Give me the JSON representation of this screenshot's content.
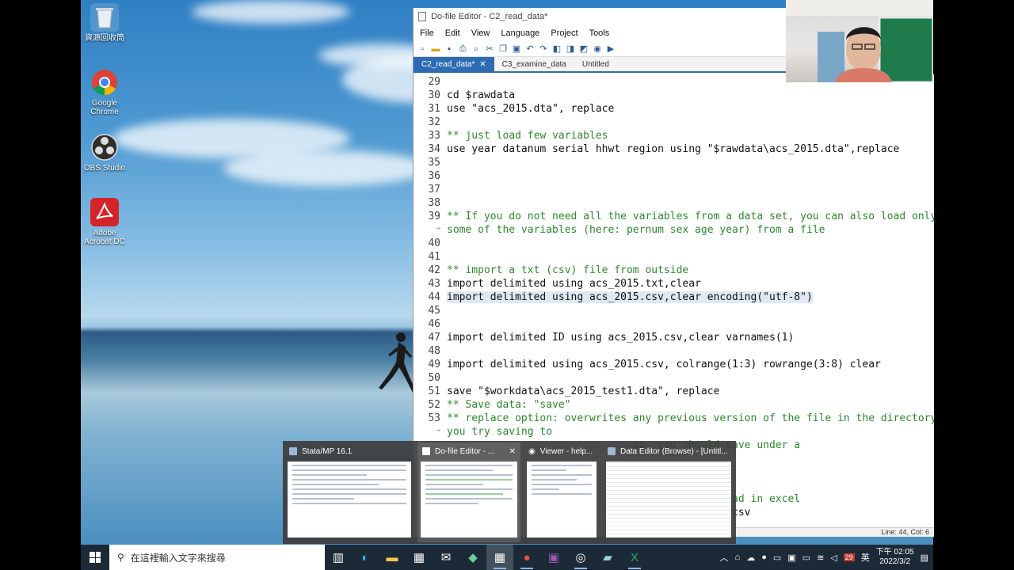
{
  "desktop": {
    "icons": [
      {
        "label": "資源回收筒",
        "name": "recycle-bin"
      },
      {
        "label": "Google Chrome",
        "name": "google-chrome"
      },
      {
        "label": "OBS Studio",
        "name": "obs-studio"
      },
      {
        "label": "Adobe Acrobat DC",
        "name": "adobe-acrobat-dc"
      }
    ]
  },
  "editor": {
    "title": "Do-file Editor - C2_read_data*",
    "menu": [
      "File",
      "Edit",
      "View",
      "Language",
      "Project",
      "Tools"
    ],
    "tabs": [
      {
        "label": "C2_read_data*",
        "active": true,
        "closable": true
      },
      {
        "label": "C3_examine_data",
        "active": false,
        "closable": false
      },
      {
        "label": "Untitled",
        "active": false,
        "closable": false
      }
    ],
    "lines": [
      {
        "n": "29",
        "text": ""
      },
      {
        "n": "30",
        "text": "cd $rawdata"
      },
      {
        "n": "31",
        "text": "use \"acs_2015.dta\", replace"
      },
      {
        "n": "32",
        "text": ""
      },
      {
        "n": "33",
        "text": "** just load few variables",
        "comment": true
      },
      {
        "n": "34",
        "text": "use year datanum serial hhwt region using \"$rawdata\\acs_2015.dta\",replace"
      },
      {
        "n": "35",
        "text": ""
      },
      {
        "n": "36",
        "text": ""
      },
      {
        "n": "37",
        "text": ""
      },
      {
        "n": "38",
        "text": ""
      },
      {
        "n": "39",
        "text": "** If you do not need all the variables from a data set, you can also load only",
        "comment": true
      },
      {
        "n": "→",
        "text": "some of the variables (here: pernum sex age year) from a file",
        "comment": true,
        "wrap": true
      },
      {
        "n": "40",
        "text": ""
      },
      {
        "n": "41",
        "text": ""
      },
      {
        "n": "42",
        "text": "** import a txt (csv) file from outside",
        "comment": true
      },
      {
        "n": "43",
        "text": "import delimited using acs_2015.txt,clear"
      },
      {
        "n": "44",
        "text": "import delimited using acs_2015.csv,clear encoding(\"utf-8\")",
        "highlight": true
      },
      {
        "n": "45",
        "text": ""
      },
      {
        "n": "46",
        "text": ""
      },
      {
        "n": "47",
        "text": "import delimited ID using acs_2015.csv,clear varnames(1)"
      },
      {
        "n": "48",
        "text": ""
      },
      {
        "n": "49",
        "text": "import delimited using acs_2015.csv, colrange(1:3) rowrange(3:8) clear"
      },
      {
        "n": "50",
        "text": ""
      },
      {
        "n": "51",
        "text": "save \"$workdata\\acs_2015_test1.dta\", replace"
      },
      {
        "n": "52",
        "text": "** Save data: \"save\"",
        "comment": true
      },
      {
        "n": "53",
        "text": "** replace option: overwrites any previous version of the file in the directory",
        "comment": true
      },
      {
        "n": "→",
        "text": "you try saving to",
        "comment": true,
        "wrap": true
      },
      {
        "n": "",
        "text": "                              up, you should save under a",
        "comment": true
      },
      {
        "n": "",
        "text": ""
      },
      {
        "n": "",
        "text": ""
      },
      {
        "n": "",
        "text": ""
      },
      {
        "n": "",
        "text": "                                     can be read in excel",
        "comment": true
      },
      {
        "n": "",
        "text": "                                     acs_2015.csv"
      }
    ],
    "status": "Line: 44, Col: 6"
  },
  "taskview": [
    {
      "title": "Stata/MP 16.1",
      "icon": "stata-icon"
    },
    {
      "title": "Do-file Editor - ...",
      "icon": "document-icon",
      "selected": true
    },
    {
      "title": "Viewer - help...",
      "icon": "eye-icon"
    },
    {
      "title": "Data Editor (Browse) - [Untitl...",
      "icon": "table-icon"
    }
  ],
  "taskbar": {
    "search_placeholder": "在這裡輸入文字來搜尋",
    "clock_time": "下午 02:05",
    "clock_date": "2022/3/2",
    "ime": "英",
    "badge": "29"
  }
}
